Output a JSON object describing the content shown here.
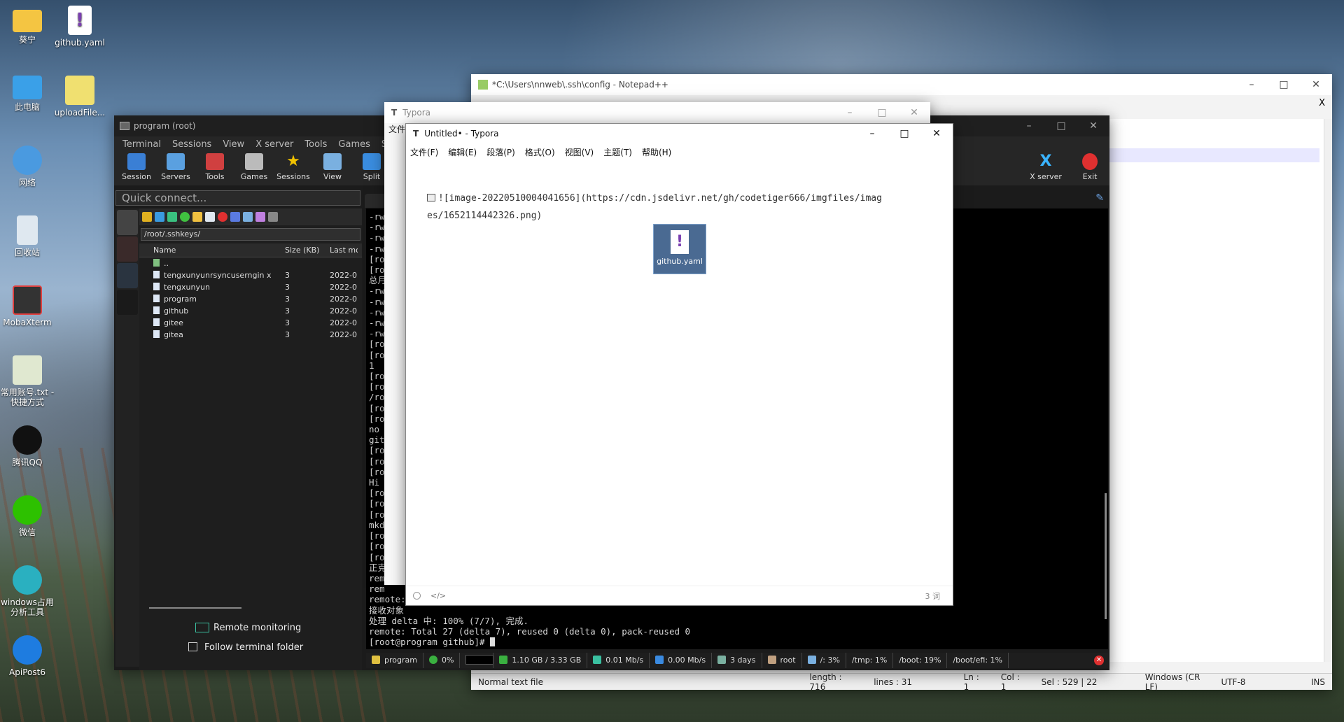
{
  "desktop": {
    "icons": [
      {
        "name": "folder-icon",
        "label": "葵宁"
      },
      {
        "name": "yaml-file-icon",
        "label": "github.yaml"
      },
      {
        "name": "this-pc-icon",
        "label": "此电脑"
      },
      {
        "name": "upload-file-icon",
        "label": "uploadFile..."
      },
      {
        "name": "network-icon",
        "label": "网络"
      },
      {
        "name": "recycle-bin-icon",
        "label": "回收站"
      },
      {
        "name": "mobaxterm-icon",
        "label": "MobaXterm"
      },
      {
        "name": "text-shortcut-icon",
        "label": "常用账号.txt - 快捷方式"
      },
      {
        "name": "qq-icon",
        "label": "腾讯QQ"
      },
      {
        "name": "wechat-icon",
        "label": "微信"
      },
      {
        "name": "windows-tool-icon",
        "label": "windows占用分析工具"
      },
      {
        "name": "apipost-icon",
        "label": "ApiPost6"
      }
    ]
  },
  "moba": {
    "title": "program (root)",
    "menu": [
      "Terminal",
      "Sessions",
      "View",
      "X server",
      "Tools",
      "Games",
      "Settings"
    ],
    "toolbar": [
      {
        "name": "session",
        "label": "Session",
        "color": "#3a7fd5"
      },
      {
        "name": "servers",
        "label": "Servers",
        "color": "#5aa0e0"
      },
      {
        "name": "tools",
        "label": "Tools",
        "color": "#d04040"
      },
      {
        "name": "games",
        "label": "Games",
        "color": "#bbbbbb"
      },
      {
        "name": "sessions",
        "label": "Sessions",
        "color": "#f2c200"
      },
      {
        "name": "view",
        "label": "View",
        "color": "#7ab0e0"
      },
      {
        "name": "split",
        "label": "Split",
        "color": "#3a8de0"
      }
    ],
    "xserver_label": "X server",
    "exit_label": "Exit",
    "quick_connect": "Quick connect...",
    "sftp": {
      "path": "/root/.sshkeys/",
      "headers": {
        "name": "Name",
        "size": "Size (KB)",
        "date": "Last mo"
      },
      "rows": [
        {
          "name": "..",
          "size": "",
          "date": ""
        },
        {
          "name": "tengxunyunrsyncuserngin x",
          "size": "3",
          "date": "2022-0"
        },
        {
          "name": "tengxunyun",
          "size": "3",
          "date": "2022-0"
        },
        {
          "name": "program",
          "size": "3",
          "date": "2022-0"
        },
        {
          "name": "github",
          "size": "3",
          "date": "2022-0"
        },
        {
          "name": "gitee",
          "size": "3",
          "date": "2022-0"
        },
        {
          "name": "gitea",
          "size": "3",
          "date": "2022-0"
        }
      ],
      "remote_monitoring": "Remote monitoring",
      "follow_terminal": "Follow terminal folder"
    },
    "terminal": {
      "lines": [
        "-rw",
        "-rw",
        "-rw",
        "-rw",
        "[ro",
        "[ro",
        "总月",
        "-rw",
        "-rw",
        "-rw",
        "-rw",
        "-rw",
        "[ro",
        "[ro",
        "1",
        "[ro",
        "[ro",
        "/ro",
        "[ro",
        "[ro",
        "no",
        "git",
        "[ro",
        "[ro",
        "[ro",
        "Hi",
        "[ro",
        "[ro",
        "[ro",
        "mkd",
        "[ro",
        "[ro",
        "[ro",
        "正克",
        "rem",
        "rem",
        "remote:",
        "接收对象",
        "处理 delta 中: 100% (7/7), 完成.",
        "remote: Total 27 (delta 7), reused 0 (delta 0), pack-reused 0",
        "[root@program github]# "
      ]
    },
    "status": {
      "host": "program",
      "cpu": "0%",
      "memory": "1.10 GB / 3.33 GB",
      "upload": "0.01 Mb/s",
      "download": "0.00 Mb/s",
      "uptime": "3 days",
      "user": "root",
      "disk_root": "/: 3%",
      "disk_tmp": "/tmp: 1%",
      "disk_boot": "/boot: 19%",
      "disk_efi": "/boot/efi: 1%"
    }
  },
  "npp": {
    "title": "*C:\\Users\\nnweb\\.ssh\\config - Notepad++",
    "close_x": "X",
    "status": {
      "type": "Normal text file",
      "length": "length : 716",
      "lines": "lines : 31",
      "ln": "Ln : 1",
      "col": "Col : 1",
      "sel": "Sel : 529 | 22",
      "eol": "Windows (CR LF)",
      "enc": "UTF-8",
      "mode": "INS"
    }
  },
  "typora_back": {
    "title": "Typora",
    "menu_first": "文件"
  },
  "typora": {
    "title": "Untitled• - Typora",
    "menu": [
      "文件(F)",
      "编辑(E)",
      "段落(P)",
      "格式(O)",
      "视图(V)",
      "主题(T)",
      "帮助(H)"
    ],
    "content_line1": "![image-20220510004041656](https://cdn.jsdelivr.net/gh/codetiger666/imgfiles/imag",
    "content_line2": "es/1652114442326.png)",
    "file_icon_label": "github.yaml",
    "word_count": "3 词"
  }
}
